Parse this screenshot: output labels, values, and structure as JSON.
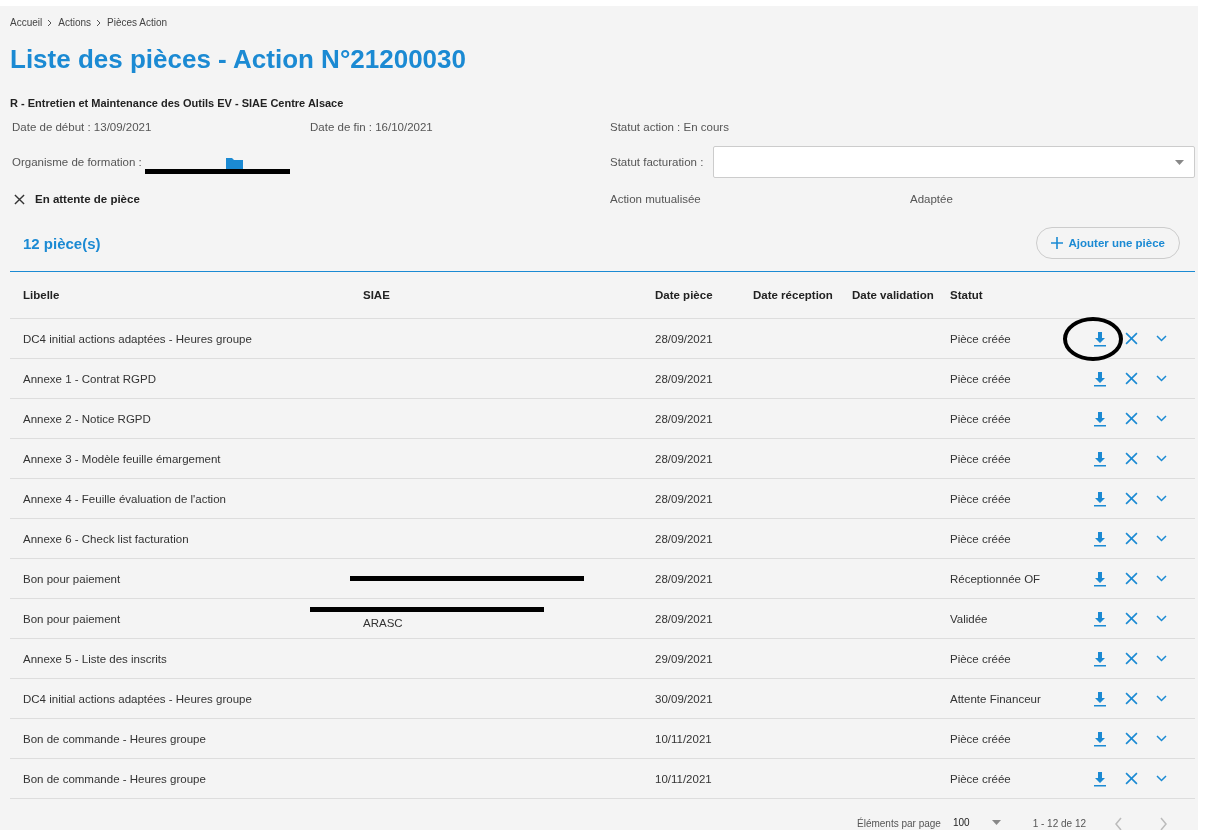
{
  "breadcrumb": [
    "Accueil",
    "Actions",
    "Pièces Action"
  ],
  "title": "Liste des pièces - Action N°21200030",
  "subtitle": "R - Entretien et Maintenance des Outils EV - SIAE Centre Alsace",
  "info": {
    "start": "Date de début : 13/09/2021",
    "end": "Date de fin : 16/10/2021",
    "status": "Statut action : En cours",
    "organisme_label": "Organisme de formation :",
    "organisme_redacted": true,
    "billing_label": "Statut facturation :",
    "waiting": "En attente de pièce",
    "mutualised": "Action mutualisée",
    "adapted": "Adaptée"
  },
  "count": "12 pièce(s)",
  "add_button": "Ajouter une pièce",
  "columns": [
    "Libelle",
    "SIAE",
    "Date pièce",
    "Date réception",
    "Date validation",
    "Statut"
  ],
  "rows": [
    {
      "label": "DC4 initial actions adaptées - Heures groupe",
      "date": "28/09/2021",
      "status": "Pièce créée",
      "circled": true,
      "redacted": false
    },
    {
      "label": "Annexe 1 - Contrat RGPD",
      "date": "28/09/2021",
      "status": "Pièce créée",
      "circled": false,
      "redacted": false
    },
    {
      "label": "Annexe 2 - Notice RGPD",
      "date": "28/09/2021",
      "status": "Pièce créée",
      "circled": false,
      "redacted": false
    },
    {
      "label": "Annexe 3 - Modèle feuille émargement",
      "date": "28/09/2021",
      "status": "Pièce créée",
      "circled": false,
      "redacted": false
    },
    {
      "label": "Annexe 4 - Feuille évaluation de l'action",
      "date": "28/09/2021",
      "status": "Pièce créée",
      "circled": false,
      "redacted": false
    },
    {
      "label": "Annexe 6 - Check list facturation",
      "date": "28/09/2021",
      "status": "Pièce créée",
      "circled": false,
      "redacted": false
    },
    {
      "label": "Bon pour paiement",
      "date": "28/09/2021",
      "status": "Réceptionnée OF",
      "circled": false,
      "redacted": true
    },
    {
      "label": "Bon pour paiement",
      "siae": "ARASC",
      "date": "28/09/2021",
      "status": "Validée",
      "circled": false,
      "redacted": true
    },
    {
      "label": "Annexe 5 - Liste des inscrits",
      "date": "29/09/2021",
      "status": "Pièce créée",
      "circled": false,
      "redacted": false
    },
    {
      "label": "DC4 initial actions adaptées - Heures groupe",
      "date": "30/09/2021",
      "status": "Attente Financeur",
      "circled": false,
      "redacted": false
    },
    {
      "label": "Bon de commande - Heures groupe",
      "date": "10/11/2021",
      "status": "Pièce créée",
      "circled": false,
      "redacted": false
    },
    {
      "label": "Bon de commande - Heures groupe",
      "date": "10/11/2021",
      "status": "Pièce créée",
      "circled": false,
      "redacted": false
    }
  ],
  "pagination": {
    "label": "Éléments par page",
    "page_size": "100",
    "range": "1 - 12 de 12"
  }
}
